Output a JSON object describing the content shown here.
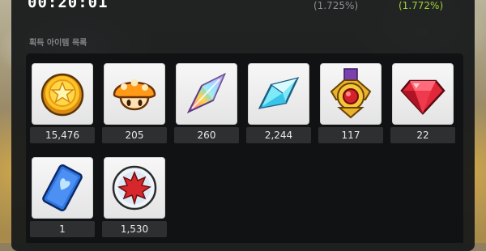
{
  "header": {
    "timer": "00:20:01",
    "rate_left": "(1.725%)",
    "rate_right": "(1.772%)"
  },
  "section_title": "획득 아이템 목록",
  "colors": {
    "panel": "#16181a",
    "accent_green": "#9ed034",
    "muted": "#8b8e90"
  },
  "items": [
    {
      "icon": "gold-coin-icon",
      "count": "15,476"
    },
    {
      "icon": "orange-mushroom-icon",
      "count": "205"
    },
    {
      "icon": "rainbow-crystal-icon",
      "count": "260"
    },
    {
      "icon": "blue-crystal-icon",
      "count": "2,244"
    },
    {
      "icon": "gold-medal-icon",
      "count": "117"
    },
    {
      "icon": "red-gem-icon",
      "count": "22"
    },
    {
      "icon": "blue-card-icon",
      "count": "1"
    },
    {
      "icon": "maple-leaf-orb-icon",
      "count": "1,530"
    }
  ]
}
